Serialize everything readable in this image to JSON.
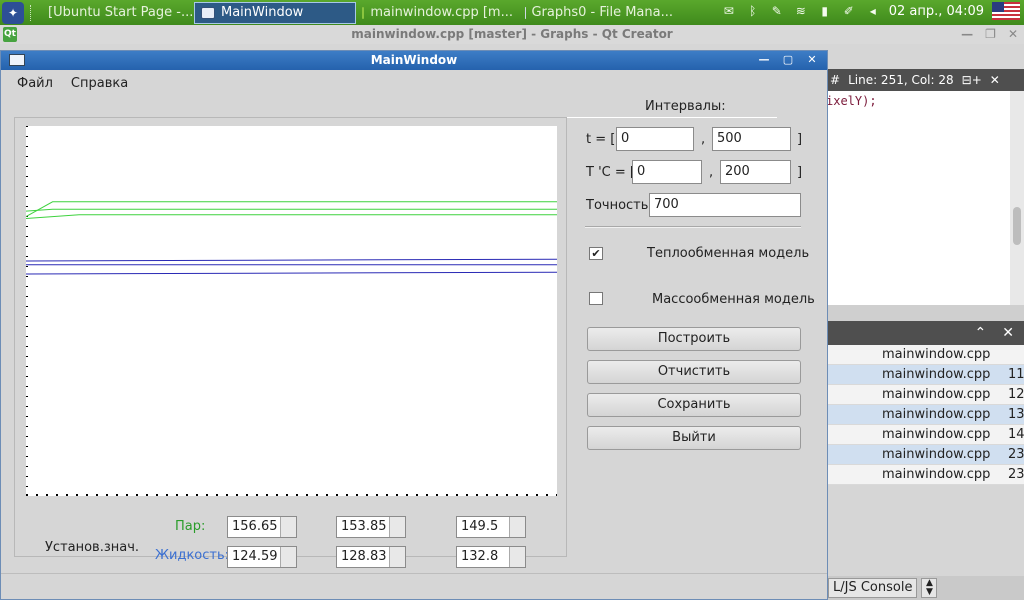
{
  "taskbar": {
    "tasks": [
      {
        "label": "[Ubuntu Start Page -..."
      },
      {
        "label": "MainWindow"
      },
      {
        "label": "mainwindow.cpp [m..."
      },
      {
        "label": "Graphs0 - File Mana..."
      }
    ],
    "clock": "02 апр., 04:09"
  },
  "qtcreator": {
    "title": "mainwindow.cpp [master] - Graphs - Qt Creator",
    "line_col": "Line: 251, Col: 28",
    "hash": "#",
    "code_line": "ixelY);",
    "outline_rows": [
      {
        "file": "mainwindow.cpp",
        "line": ""
      },
      {
        "file": "mainwindow.cpp",
        "line": "11"
      },
      {
        "file": "mainwindow.cpp",
        "line": "12"
      },
      {
        "file": "mainwindow.cpp",
        "line": "13"
      },
      {
        "file": "mainwindow.cpp",
        "line": "14"
      },
      {
        "file": "mainwindow.cpp",
        "line": "23"
      },
      {
        "file": "mainwindow.cpp",
        "line": "23"
      }
    ],
    "console_label": "L/JS Console"
  },
  "window": {
    "title": "MainWindow",
    "menu": {
      "file": "Файл",
      "help": "Справка"
    }
  },
  "controls": {
    "intervals_label": "Интервалы:",
    "t_label": "t = [",
    "t_from": "0",
    "t_to": "500",
    "temp_label": "T 'C = [",
    "temp_from": "0",
    "temp_to": "200",
    "comma": ",",
    "close_bracket": "]",
    "precision_label": "Точность",
    "precision_value": "700",
    "heat_model": {
      "label": "Теплообменная модель",
      "checked": true,
      "mark": "✔"
    },
    "mass_model": {
      "label": "Массообменная модель",
      "checked": false
    },
    "buttons": {
      "build": "Построить",
      "clear": "Отчистить",
      "save": "Сохранить",
      "exit": "Выйти"
    }
  },
  "bottom": {
    "steady_label": "Установ.знач.",
    "steam_label": "Пар:",
    "liquid_label": "Жидкость:",
    "steam_values": [
      "156.65",
      "153.85",
      "149.5"
    ],
    "liquid_values": [
      "124.59",
      "128.83",
      "132.8"
    ],
    "steam_color": "#2a9d2a",
    "liquid_color": "#3a6fd1"
  },
  "chart_data": {
    "type": "line",
    "series": [
      {
        "color": "#3fd23f",
        "points": [
          [
            0,
            0.755
          ],
          [
            0.05,
            0.795
          ],
          [
            1,
            0.795
          ]
        ]
      },
      {
        "color": "#3fd23f",
        "points": [
          [
            0,
            0.77
          ],
          [
            0.05,
            0.775
          ],
          [
            1,
            0.775
          ]
        ]
      },
      {
        "color": "#3fd23f",
        "points": [
          [
            0,
            0.75
          ],
          [
            0.1,
            0.76
          ],
          [
            1,
            0.76
          ]
        ]
      },
      {
        "color": "#2a2ab5",
        "points": [
          [
            0,
            0.635
          ],
          [
            1,
            0.64
          ]
        ]
      },
      {
        "color": "#2a2ab5",
        "points": [
          [
            0,
            0.625
          ],
          [
            1,
            0.625
          ]
        ]
      },
      {
        "color": "#2a2ab5",
        "points": [
          [
            0,
            0.6
          ],
          [
            1,
            0.605
          ]
        ]
      }
    ]
  }
}
